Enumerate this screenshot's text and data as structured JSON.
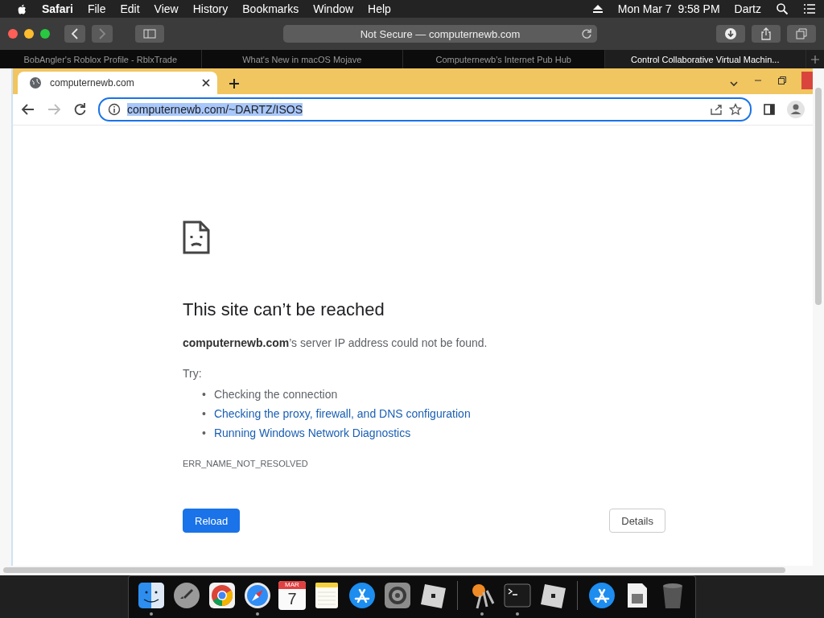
{
  "menubar": {
    "app_name": "Safari",
    "menus": [
      "File",
      "Edit",
      "View",
      "History",
      "Bookmarks",
      "Window",
      "Help"
    ],
    "clock": "Mon Mar 7  9:58 PM",
    "user": "Dartz"
  },
  "safari": {
    "address": "Not Secure — computernewb.com",
    "back_disabled": false,
    "forward_disabled": true,
    "tabs": [
      {
        "label": "BobAngler's Roblox Profile - RblxTrade",
        "selected": false
      },
      {
        "label": "What's New in macOS Mojave",
        "selected": false
      },
      {
        "label": "Computernewb's Internet Pub Hub",
        "selected": false
      },
      {
        "label": "Control Collaborative Virtual Machin...",
        "selected": true
      }
    ]
  },
  "chrome": {
    "tab": {
      "label": "computernewb.com"
    },
    "url": "computernewb.com/~DARTZ/ISOS",
    "url_selected": true,
    "forward_disabled": true
  },
  "error_page": {
    "title": "This site can’t be reached",
    "message": "**computernewb.com**’s server IP address could not be found.",
    "try_label": "Try:",
    "suggestions": [
      {
        "bullet": "•",
        "text": "Checking the connection",
        "kind": "plain"
      },
      {
        "bullet": "•",
        "text": "Checking the proxy, firewall, and DNS configuration",
        "kind": "link"
      },
      {
        "bullet": "•",
        "text": "Running Windows Network Diagnostics",
        "kind": "link"
      }
    ],
    "error_code": "ERR_NAME_NOT_RESOLVED",
    "buttons": [
      {
        "label": "Reload",
        "kind": "primary"
      },
      {
        "label": "Details",
        "kind": "secondary"
      }
    ]
  },
  "dock": {
    "items": [
      {
        "kind": "finder",
        "running": true
      },
      {
        "kind": "launchpad",
        "running": false
      },
      {
        "kind": "chrome",
        "running": false
      },
      {
        "kind": "safari",
        "running": true
      },
      {
        "kind": "calendar",
        "running": false,
        "month": "MAR",
        "day": "7"
      },
      {
        "kind": "notes",
        "running": false
      },
      {
        "kind": "appstore",
        "running": false
      },
      {
        "kind": "settings",
        "running": false
      },
      {
        "kind": "roblox",
        "running": false
      },
      {
        "kind": "separator"
      },
      {
        "kind": "keychain",
        "running": true
      },
      {
        "kind": "terminal",
        "running": true
      },
      {
        "kind": "roblox",
        "running": false
      },
      {
        "kind": "separator"
      },
      {
        "kind": "appstore",
        "running": false
      },
      {
        "kind": "document",
        "running": false
      },
      {
        "kind": "trash",
        "running": false
      }
    ]
  }
}
